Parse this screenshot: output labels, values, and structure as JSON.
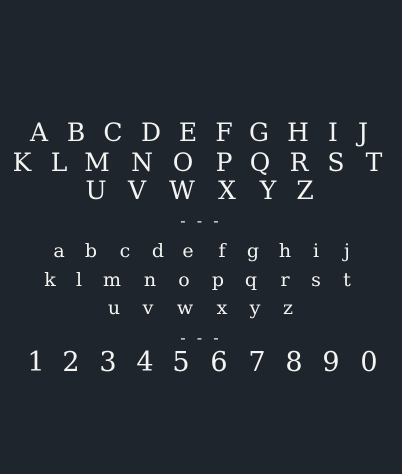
{
  "specimen": {
    "uppercase_row_1": [
      "A",
      "B",
      "C",
      "D",
      "E",
      "F",
      "G",
      "H",
      "I",
      "J"
    ],
    "uppercase_row_2": [
      "K",
      "L",
      "M",
      "N",
      "O",
      "P",
      "Q",
      "R",
      "S",
      "T"
    ],
    "uppercase_row_3": [
      "U",
      "V",
      "W",
      "X",
      "Y",
      "Z"
    ],
    "separator_1": "- - -",
    "lowercase_row_1": [
      "a",
      "b",
      "c",
      "d",
      "e",
      "f",
      "g",
      "h",
      "i",
      "j"
    ],
    "lowercase_row_2": [
      "k",
      "l",
      "m",
      "n",
      "o",
      "p",
      "q",
      "r",
      "s",
      "t"
    ],
    "lowercase_row_3": [
      "u",
      "v",
      "w",
      "x",
      "y",
      "z"
    ],
    "separator_2": "- - -",
    "digits": [
      "1",
      "2",
      "3",
      "4",
      "5",
      "6",
      "7",
      "8",
      "9",
      "0"
    ]
  }
}
